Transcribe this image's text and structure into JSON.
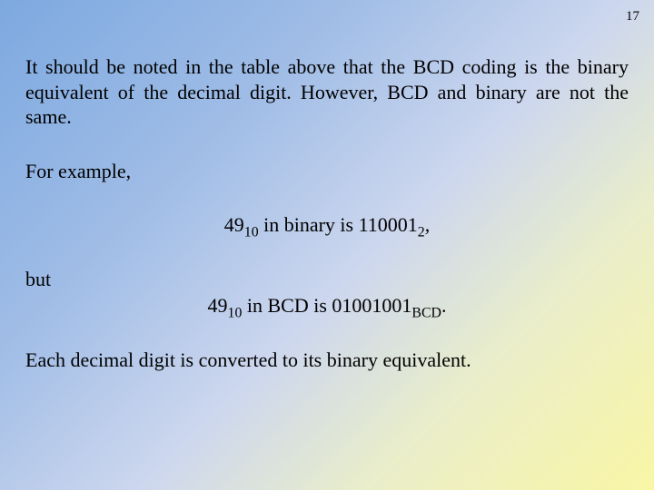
{
  "page_number": "17",
  "para1": "It should be noted in the table above that the BCD coding is the binary equivalent of the decimal digit. However, BCD and binary are not the same.",
  "for_example": "For example,",
  "line_binary": {
    "num": "49",
    "num_sub": "10",
    "mid": " in binary is ",
    "val": "110001",
    "val_sub": "2",
    "tail": ","
  },
  "but": "but",
  "line_bcd": {
    "num": "49",
    "num_sub": "10",
    "mid": " in BCD is ",
    "val": "01001001",
    "val_sub": "BCD",
    "tail": "."
  },
  "closing": "Each decimal digit is converted to its binary equivalent."
}
